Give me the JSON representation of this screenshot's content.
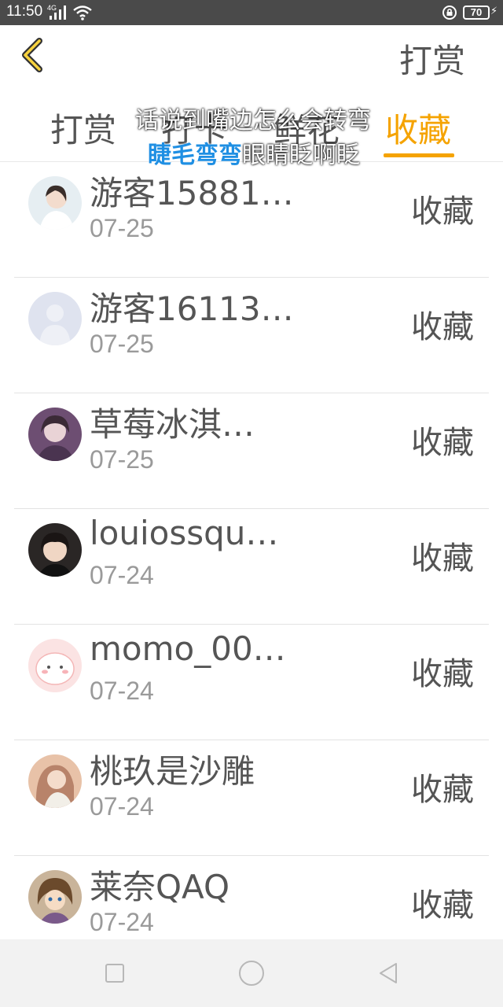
{
  "status_bar": {
    "time": "11:50",
    "network": "4G",
    "battery": "70"
  },
  "header": {
    "action_label": "打赏"
  },
  "tabs": [
    {
      "label": "打赏"
    },
    {
      "label": "打卡"
    },
    {
      "label": "鲜花"
    },
    {
      "label": "收藏",
      "active": true
    }
  ],
  "lyric": {
    "line1": "话说到嘴边怎么会转弯",
    "line2_highlight": "睫毛弯弯",
    "line2_rest": "眼睛眨啊眨"
  },
  "records": [
    {
      "name": "游客15881…",
      "date": "07-25",
      "action": "收藏",
      "avatar": "avatar-woman-photo"
    },
    {
      "name": "游客16113…",
      "date": "07-25",
      "action": "收藏",
      "avatar": "default-user-icon"
    },
    {
      "name": "草莓冰淇…",
      "date": "07-25",
      "action": "收藏",
      "avatar": "avatar-purple-photo"
    },
    {
      "name": "louiossqu…",
      "date": "07-24",
      "action": "收藏",
      "avatar": "avatar-child-photo"
    },
    {
      "name": "momo_00…",
      "date": "07-24",
      "action": "收藏",
      "avatar": "avatar-pink-cartoon"
    },
    {
      "name": "桃玖是沙雕",
      "date": "07-24",
      "action": "收藏",
      "avatar": "avatar-girl-photo"
    },
    {
      "name": "莱奈QAQ",
      "date": "07-24",
      "action": "收藏",
      "avatar": "avatar-anime-photo"
    }
  ],
  "colors": {
    "accent": "#f5a300",
    "status_bar": "#4a4a4a",
    "text": "#555555",
    "date_text": "#9a9a9a"
  }
}
